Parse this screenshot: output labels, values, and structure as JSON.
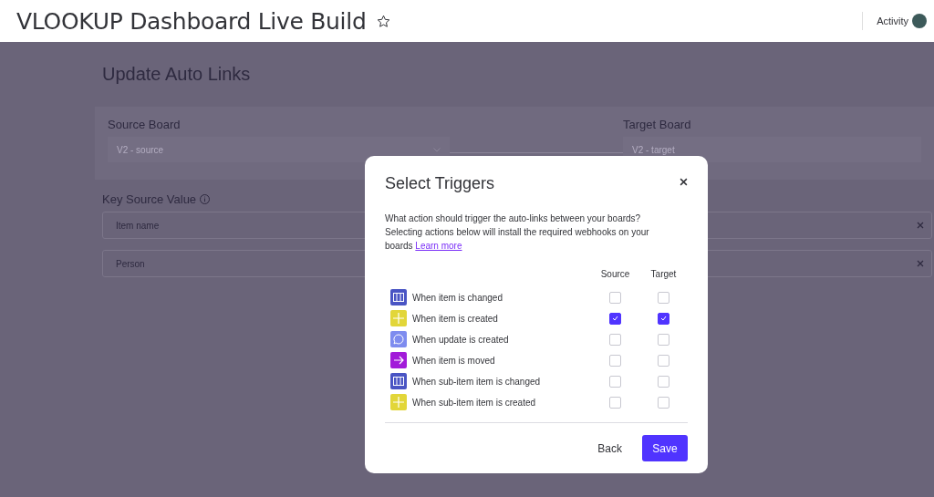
{
  "header": {
    "title": "VLOOKUP Dashboard Live Build",
    "starred": false,
    "activity_label": "Activity"
  },
  "page": {
    "title": "Update Auto Links",
    "source_board": {
      "label": "Source Board",
      "value": "V2 - source"
    },
    "target_board": {
      "label": "Target Board",
      "value": "V2 - target"
    },
    "key_source": {
      "label": "Key Source Value",
      "fields": [
        "Item name",
        "Person"
      ]
    }
  },
  "dialog": {
    "title": "Select Triggers",
    "description": "What action should trigger the auto-links between your boards? Selecting actions below will install the required webhooks on your boards",
    "link": "Learn more",
    "columns": [
      "Source",
      "Target"
    ],
    "triggers": [
      {
        "kind": "board",
        "label": "When item is changed",
        "source": false,
        "target": false
      },
      {
        "kind": "plus",
        "label": "When item is created",
        "source": true,
        "target": true
      },
      {
        "kind": "chat",
        "label": "When update is created",
        "source": false,
        "target": false
      },
      {
        "kind": "arrow",
        "label": "When item is moved",
        "source": false,
        "target": false
      },
      {
        "kind": "board",
        "label": "When sub-item item is changed",
        "source": false,
        "target": false
      },
      {
        "kind": "plus",
        "label": "When sub-item item is created",
        "source": false,
        "target": false
      }
    ],
    "buttons": {
      "back": "Back",
      "save": "Save"
    }
  }
}
